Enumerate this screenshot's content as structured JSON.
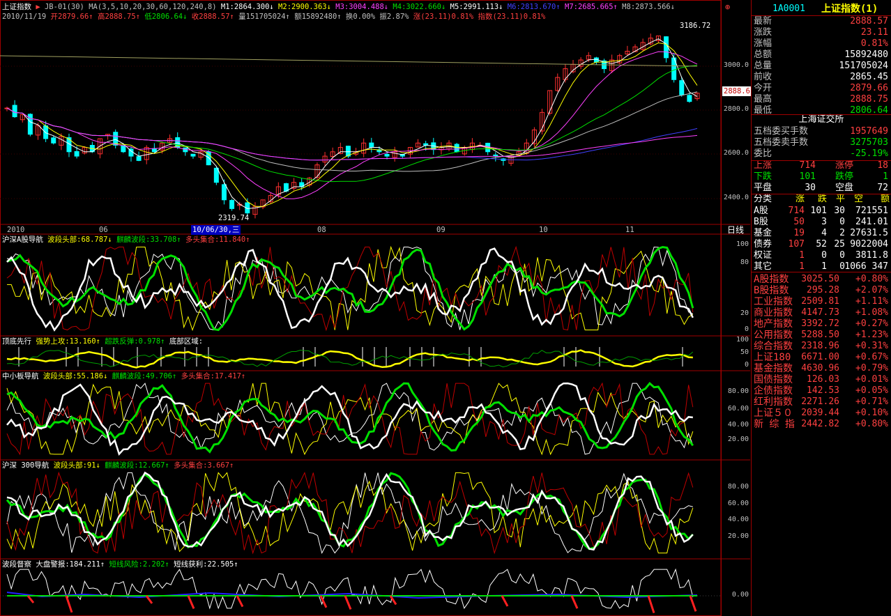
{
  "header": {
    "title": "上证指数",
    "indicator": "JB-01(30)",
    "ma_label": "MA(3,5,10,20,30,60,120,240,8)",
    "ma_values": [
      {
        "label": "M1:2864.300↓",
        "color": "#ffffff"
      },
      {
        "label": "M2:2900.363↓",
        "color": "#ffff00"
      },
      {
        "label": "M3:3004.488↓",
        "color": "#ff40ff"
      },
      {
        "label": "M4:3022.660↓",
        "color": "#00e000"
      },
      {
        "label": "M5:2991.113↓",
        "color": "#ffffff"
      },
      {
        "label": "M6:2813.670↑",
        "color": "#4040ff"
      },
      {
        "label": "M7:2685.665↑",
        "color": "#ff40ff"
      },
      {
        "label": "M8:2873.566↓",
        "color": "#c0c0c0"
      }
    ],
    "info_line": [
      {
        "label": "2010/11/19",
        "color": "#c0c0c0"
      },
      {
        "label": "开2879.66↑",
        "color": "#ff4040"
      },
      {
        "label": "高2888.75↑",
        "color": "#ff4040"
      },
      {
        "label": "低2806.64↓",
        "color": "#00e000"
      },
      {
        "label": "收2888.57↑",
        "color": "#ff4040"
      },
      {
        "label": "量151705024↑",
        "color": "#c0c0c0"
      },
      {
        "label": "额15892480↑",
        "color": "#c0c0c0"
      },
      {
        "label": "换0.00%",
        "color": "#c0c0c0"
      },
      {
        "label": "振2.87%",
        "color": "#c0c0c0"
      },
      {
        "label": "涨(23.11)0.81%",
        "color": "#ff4040"
      },
      {
        "label": "指数(23.11)0.81%",
        "color": "#ff4040"
      }
    ],
    "price_high_label": "3186.72",
    "price_low_label": "2319.74",
    "current_tag": "2888.6"
  },
  "x_axis": {
    "labels": [
      "2010",
      "06",
      "08",
      "09",
      "10",
      "11"
    ],
    "cursor_date": "10/06/30,三",
    "period": "日线"
  },
  "panels": [
    {
      "title": "沪深A股导航",
      "items": [
        {
          "label": "波段头部:68.787↓",
          "color": "#ffff00"
        },
        {
          "label": "麒麟波段:33.708↑",
          "color": "#00e000"
        },
        {
          "label": "多头集合:11.840↑",
          "color": "#ff4040"
        }
      ],
      "ticks": [
        "100",
        "80",
        "20",
        "0"
      ]
    },
    {
      "title": "顶底先行",
      "items": [
        {
          "label": "强势上攻:13.160↑",
          "color": "#ffff00"
        },
        {
          "label": "超跌反弹:0.978↑",
          "color": "#00e000"
        },
        {
          "label": "底部区域:",
          "color": "#ffffff"
        }
      ],
      "ticks": [
        "100",
        "50",
        "0"
      ]
    },
    {
      "title": "中小板导航",
      "items": [
        {
          "label": "波段头部:55.186↓",
          "color": "#ffff00"
        },
        {
          "label": "麒麟波段:49.706↑",
          "color": "#00e000"
        },
        {
          "label": "多头集合:17.417↑",
          "color": "#ff4040"
        }
      ],
      "ticks": [
        "80.00",
        "60.00",
        "40.00",
        "20.00"
      ]
    },
    {
      "title": "沪深 300导航",
      "items": [
        {
          "label": "波段头部:91↓",
          "color": "#ffff00"
        },
        {
          "label": "麒麟波段:12.667↑",
          "color": "#00e000"
        },
        {
          "label": "多头集合:3.667↑",
          "color": "#ff4040"
        }
      ],
      "ticks": [
        "80.00",
        "60.00",
        "40.00",
        "20.00"
      ]
    },
    {
      "title": "波段督察",
      "items": [
        {
          "label": "大盘警报:184.211↑",
          "color": "#ffffff"
        },
        {
          "label": "短线风险:2.202↑",
          "color": "#00e000"
        },
        {
          "label": "短线获利:22.505↑",
          "color": "#ffffff"
        }
      ],
      "ticks": [
        "0.00"
      ]
    }
  ],
  "price_ticks": [
    "3000.0",
    "2800.0",
    "2600.0",
    "2400.0"
  ],
  "right_panel": {
    "code": "1A0001",
    "name": "上证指数(1)",
    "quote": [
      {
        "label": "最新",
        "value": "2888.57",
        "color": "#ff4040"
      },
      {
        "label": "涨跌",
        "value": "23.11",
        "color": "#ff4040"
      },
      {
        "label": "涨幅",
        "value": "0.81%",
        "color": "#ff4040"
      },
      {
        "label": "总额",
        "value": "15892480",
        "color": "#ffffff"
      },
      {
        "label": "总量",
        "value": "151705024",
        "color": "#ffffff"
      },
      {
        "label": "前收",
        "value": "2865.45",
        "color": "#ffffff"
      },
      {
        "label": "今开",
        "value": "2879.66",
        "color": "#ff4040"
      },
      {
        "label": "最高",
        "value": "2888.75",
        "color": "#ff4040"
      },
      {
        "label": "最低",
        "value": "2806.64",
        "color": "#00e000"
      }
    ],
    "exchange": "上海证交所",
    "orders": [
      {
        "label": "五档委买手数",
        "value": "1957649",
        "color": "#ff4040"
      },
      {
        "label": "五档委卖手数",
        "value": "3275703",
        "color": "#00e000"
      },
      {
        "label": "委比",
        "value": "-25.19%",
        "color": "#00e000"
      }
    ],
    "breadth": [
      {
        "l1": "上涨",
        "v1": "714",
        "l2": "涨停",
        "v2": "18",
        "c": "#ff4040"
      },
      {
        "l1": "下跌",
        "v1": "101",
        "l2": "跌停",
        "v2": "1",
        "c": "#00e000"
      },
      {
        "l1": "平盘",
        "v1": "30",
        "l2": "空盘",
        "v2": "72",
        "c": "#ffffff"
      }
    ],
    "table_header": [
      "分类",
      "涨",
      "跌",
      "平",
      "空",
      "额"
    ],
    "table_rows": [
      {
        "name": "A股",
        "up": "714",
        "down": "101",
        "flat": "30",
        "amt": "721551"
      },
      {
        "name": "B股",
        "up": "50",
        "down": "3",
        "flat": "0",
        "amt": "241.01"
      },
      {
        "name": "基金",
        "up": "19",
        "down": "4",
        "flat": "2",
        "amt": "27631.5"
      },
      {
        "name": "债券",
        "up": "107",
        "down": "52",
        "flat": "25",
        "amt": "9022004"
      },
      {
        "name": "权证",
        "up": "1",
        "down": "0",
        "flat": "0",
        "amt": "3811.8"
      },
      {
        "name": "其它",
        "up": "1",
        "down": "1",
        "flat": "0",
        "amt": "1066 347"
      }
    ],
    "indices": [
      {
        "name": "A股指数",
        "value": "3025.50",
        "pct": "+0.80%"
      },
      {
        "name": "B股指数",
        "value": "295.28",
        "pct": "+2.07%"
      },
      {
        "name": "工业指数",
        "value": "2509.81",
        "pct": "+1.11%"
      },
      {
        "name": "商业指数",
        "value": "4147.73",
        "pct": "+1.08%"
      },
      {
        "name": "地产指数",
        "value": "3392.72",
        "pct": "+0.27%"
      },
      {
        "name": "公用指数",
        "value": "5288.50",
        "pct": "+1.23%"
      },
      {
        "name": "综合指数",
        "value": "2318.96",
        "pct": "+0.31%"
      },
      {
        "name": "上证180",
        "value": "6671.00",
        "pct": "+0.67%"
      },
      {
        "name": "基金指数",
        "value": "4630.96",
        "pct": "+0.79%"
      },
      {
        "name": "国债指数",
        "value": "126.03",
        "pct": "+0.01%"
      },
      {
        "name": "企债指数",
        "value": "142.53",
        "pct": "+0.05%"
      },
      {
        "name": "红利指数",
        "value": "2271.26",
        "pct": "+0.71%"
      },
      {
        "name": "上证５０",
        "value": "2039.44",
        "pct": "+0.10%"
      },
      {
        "name": "新 综 指",
        "value": "2442.82",
        "pct": "+0.80%"
      }
    ]
  },
  "chart_data": {
    "type": "candlestick",
    "title": "上证指数",
    "x": [
      "2010",
      "06",
      "08",
      "09",
      "10",
      "11"
    ],
    "ylim": [
      2319.74,
      3186.72
    ],
    "y_ticks": [
      2400,
      2600,
      2800,
      3000
    ],
    "last_close": 2888.57,
    "high_marker": 3186.72,
    "low_marker": 2319.74,
    "closes": [
      2820,
      2780,
      2790,
      2700,
      2740,
      2680,
      2660,
      2690,
      2620,
      2600,
      2640,
      2620,
      2680,
      2700,
      2650,
      2620,
      2600,
      2580,
      2640,
      2620,
      2660,
      2680,
      2640,
      2620,
      2600,
      2620,
      2560,
      2480,
      2400,
      2360,
      2380,
      2340,
      2370,
      2400,
      2420,
      2460,
      2440,
      2480,
      2460,
      2500,
      2560,
      2600,
      2620,
      2640,
      2600,
      2620,
      2660,
      2640,
      2620,
      2600,
      2620,
      2600,
      2640,
      2660,
      2650,
      2630,
      2640,
      2660,
      2620,
      2640,
      2660,
      2650,
      2620,
      2600,
      2580,
      2600,
      2620,
      2660,
      2720,
      2800,
      2900,
      2960,
      3000,
      3020,
      3040,
      3060,
      3030,
      3000,
      3040,
      3060,
      3080,
      3100,
      3120,
      3140,
      3150,
      3050,
      2950,
      2880,
      2850,
      2888
    ],
    "series": [
      {
        "name": "M1",
        "values": [
          2864.3
        ]
      },
      {
        "name": "M2",
        "values": [
          2900.363
        ]
      },
      {
        "name": "M3",
        "values": [
          3004.488
        ]
      },
      {
        "name": "M4",
        "values": [
          3022.66
        ]
      },
      {
        "name": "M5",
        "values": [
          2991.113
        ]
      },
      {
        "name": "M6",
        "values": [
          2813.67
        ]
      },
      {
        "name": "M7",
        "values": [
          2685.665
        ]
      },
      {
        "name": "M8",
        "values": [
          2873.566
        ]
      }
    ]
  }
}
